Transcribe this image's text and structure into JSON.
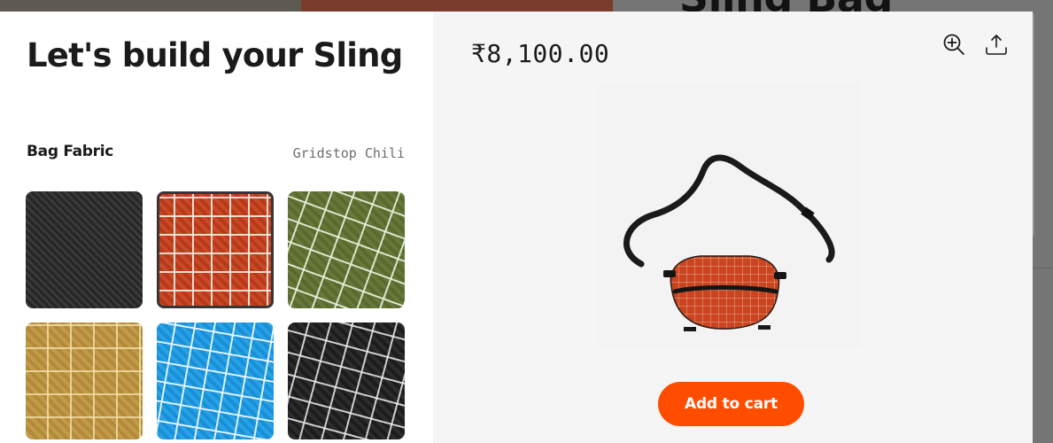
{
  "background": {
    "heading": "Sling Bag"
  },
  "modal": {
    "title": "Let's build your Sling",
    "option": {
      "label": "Bag Fabric",
      "selected_value": "Gridstop Chili"
    },
    "swatches": [
      {
        "name": "black-weave",
        "selected": false
      },
      {
        "name": "gridstop-chili",
        "selected": true
      },
      {
        "name": "olive-grid",
        "selected": false
      },
      {
        "name": "tan-grid",
        "selected": false
      },
      {
        "name": "blue-grid",
        "selected": false
      },
      {
        "name": "black-grid",
        "selected": false
      }
    ],
    "price": "₹8,100.00",
    "icons": {
      "zoom": "zoom-in-icon",
      "share": "share-icon"
    },
    "cart_button": "Add to cart",
    "colors": {
      "accent": "#ff4d00",
      "selected_fabric": "#c4431f",
      "text": "#1b1b1b",
      "muted_text": "#6d6d6d",
      "panel_bg": "#f5f5f5"
    }
  }
}
